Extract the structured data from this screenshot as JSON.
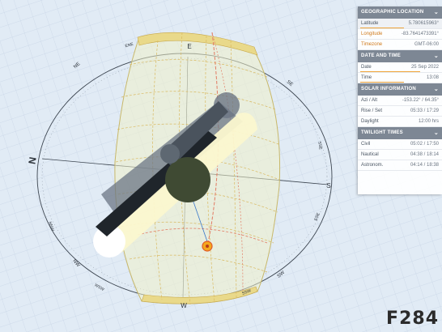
{
  "compass": {
    "north": "N",
    "south": "S",
    "east": "E",
    "west": "W",
    "ne": "NE",
    "nw": "NW",
    "se": "SE",
    "sw": "SW",
    "wsw": "WSW",
    "nnw": "NNW",
    "ssw": "SSW",
    "sse": "SSE",
    "ese": "ESE",
    "ene": "ENE"
  },
  "panel": {
    "geo_title": "GEOGRAPHIC LOCATION",
    "latitude_label": "Latitude",
    "latitude_value": "5.780615963°",
    "longitude_label": "Longitude",
    "longitude_value": "-83.7641473391°",
    "timezone_label": "Timezone",
    "timezone_value": "GMT-06:00",
    "date_title": "DATE AND TIME",
    "date_label": "Date",
    "date_value": "25 Sep 2022",
    "time_label": "Time",
    "time_value": "13:08",
    "solar_title": "SOLAR INFORMATION",
    "azi_label": "Azi / Alt",
    "azi_value": "-153.22° / 64.35°",
    "rise_label": "Rise / Set",
    "rise_value": "05:33 / 17:29",
    "daylight_label": "Daylight",
    "daylight_value": "12:00 hrs",
    "twilight_title": "TWILIGHT TIMES",
    "civil_label": "Civil",
    "civil_value": "05:02 / 17:50",
    "nautical_label": "Nautical",
    "nautical_value": "04:38 / 18:14",
    "astro_label": "Astronom.",
    "astro_value": "04:14 / 18:38"
  },
  "progress": {
    "latitude": 0.55,
    "date": 0.75,
    "time": 0.55
  },
  "watermark": "F284",
  "colors": {
    "sun": "#f4a81e",
    "orbit": "#e27b63",
    "shade": "#f4f3c8",
    "shadow": "#6b7684"
  }
}
